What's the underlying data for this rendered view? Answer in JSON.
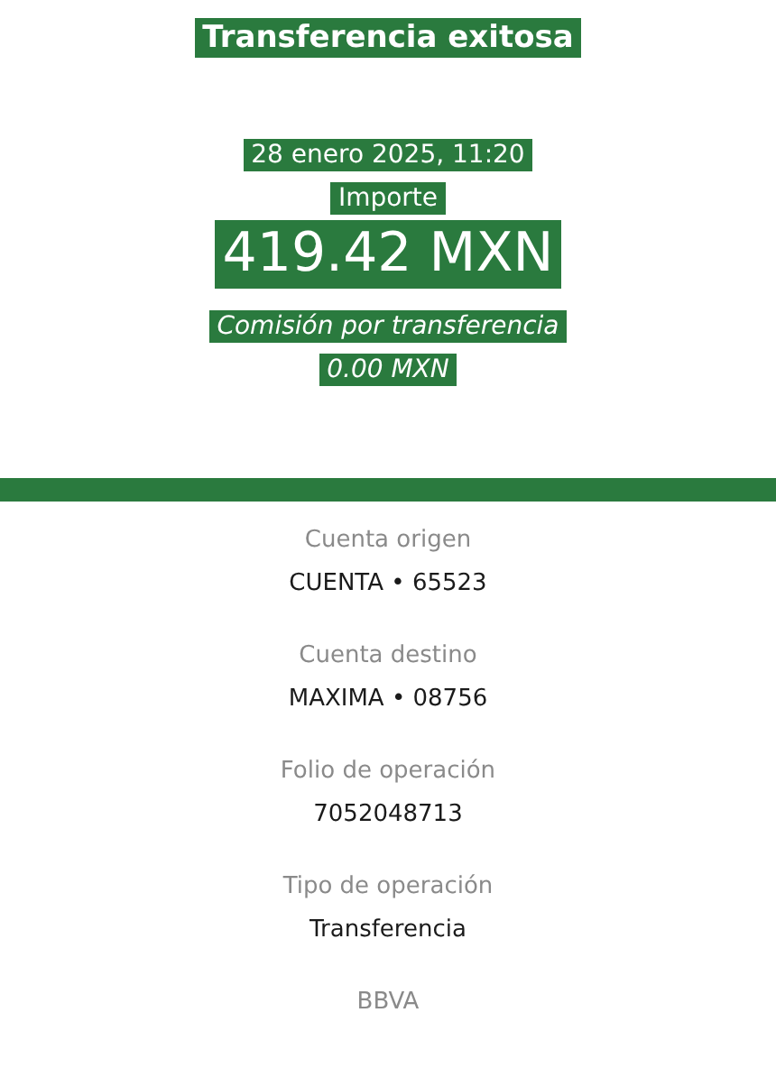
{
  "header": {
    "title": "Transferencia exitosa",
    "date": "28 enero 2025, 11:20",
    "amount_label": "Importe",
    "amount": "419.42 MXN",
    "fee_label": "Comisión por transferencia",
    "fee": "0.00 MXN"
  },
  "details": [
    {
      "label": "Cuenta origen",
      "value": "CUENTA • 65523"
    },
    {
      "label": "Cuenta destino",
      "value": "MAXIMA • 08756"
    },
    {
      "label": "Folio de operación",
      "value": "7052048713"
    },
    {
      "label": "Tipo de operación",
      "value": "Transferencia"
    }
  ],
  "footer": "BBVA"
}
